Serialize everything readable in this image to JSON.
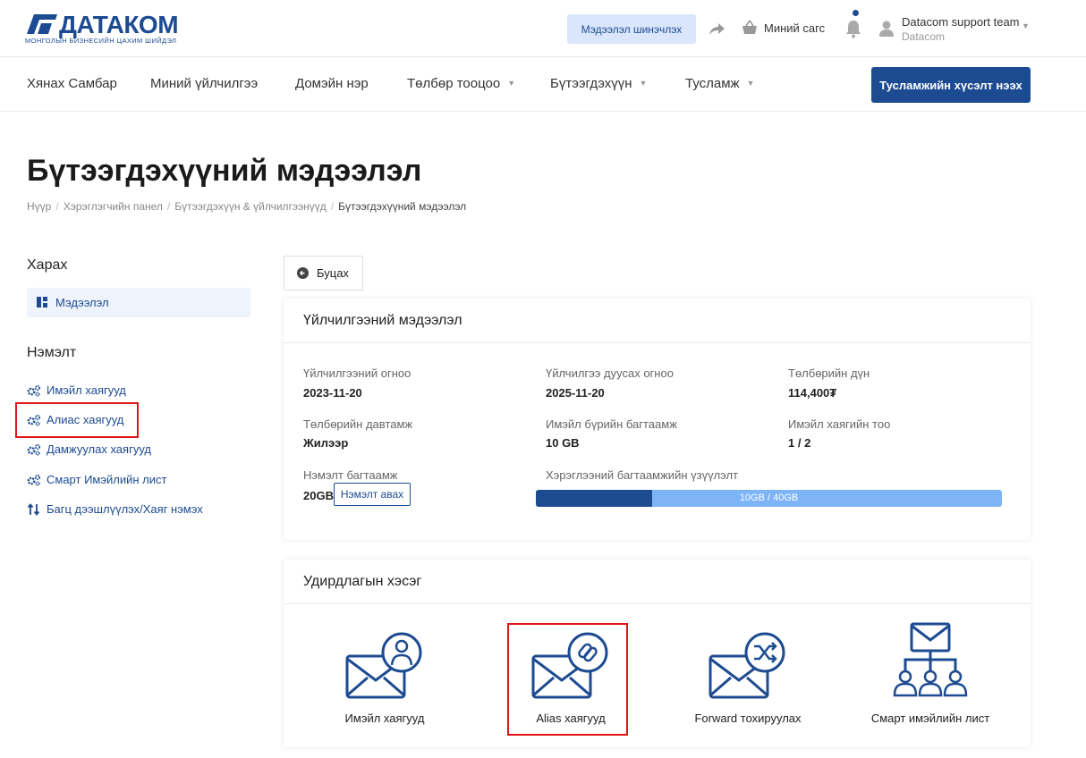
{
  "brand": {
    "name": "ДАТАКОМ",
    "tagline": "МОНГОЛЫН БИЗНЕСИЙН ЦАХИМ ШИЙДЭЛ",
    "color": "#1d4b91"
  },
  "header": {
    "update_label": "Мэдээлэл шинэчлэх",
    "cart_label": "Миний сагс",
    "user_name": "Datacom support team",
    "user_company": "Datacom"
  },
  "nav": {
    "items": [
      {
        "label": "Хянах Самбар"
      },
      {
        "label": "Миний үйлчилгээ"
      },
      {
        "label": "Домэйн нэр"
      },
      {
        "label": "Төлбөр тооцоо"
      },
      {
        "label": "Бүтээгдэхүүн"
      },
      {
        "label": "Тусламж"
      }
    ],
    "support_button": "Тусламжийн хүсэлт нээх"
  },
  "page": {
    "title": "Бүтээгдэхүүний мэдээлэл",
    "breadcrumb": [
      "Нүүр",
      "Хэрэглэгчийн панел",
      "Бүтээгдэхүүн & үйлчилгээнүүд",
      "Бүтээгдэхүүний мэдээлэл"
    ]
  },
  "sidebar": {
    "view_title": "Харах",
    "view_item": "Мэдээлэл",
    "extra_title": "Нэмэлт",
    "links": [
      {
        "label": "Имэйл хаягууд",
        "icon": "gears-icon"
      },
      {
        "label": "Алиас хаягууд",
        "icon": "gears-icon"
      },
      {
        "label": "Дамжуулах хаягууд",
        "icon": "gears-icon"
      },
      {
        "label": "Смарт Имэйлийн лист",
        "icon": "gears-icon"
      },
      {
        "label": "Багц дээшлүүлэх/Хаяг нэмэх",
        "icon": "updown-arrows-icon"
      }
    ]
  },
  "back_button": "Буцах",
  "service": {
    "title": "Үйлчилгээний мэдээлэл",
    "fields": [
      {
        "label": "Үйлчилгээний огноо",
        "value": "2023-11-20"
      },
      {
        "label": "Үйлчилгээ дуусах огноо",
        "value": "2025-11-20"
      },
      {
        "label": "Төлбөрийн дүн",
        "value": "114,400₮"
      },
      {
        "label": "Төлбөрийн давтамж",
        "value": "Жилээр"
      },
      {
        "label": "Имэйл бүрийн багтаамж",
        "value": "10 GB"
      },
      {
        "label": "Имэйл хаягийн тоо",
        "value": "1 / 2"
      }
    ],
    "addon_label": "Нэмэлт багтаамж",
    "addon_value": "20GB",
    "addon_button": "Нэмэлт авах",
    "usage_label": "Хэрэглээний багтаамжийн үзүүлэлт",
    "usage_text": "10GB / 40GB",
    "usage_fraction": 0.25
  },
  "control": {
    "title": "Удирдлагын хэсэг",
    "tiles": [
      {
        "label": "Имэйл хаягууд",
        "icon": "email-user-icon"
      },
      {
        "label": "Alias хаягууд",
        "icon": "email-link-icon"
      },
      {
        "label": "Forward тохируулах",
        "icon": "email-forward-icon"
      },
      {
        "label": "Смарт имэйлийн лист",
        "icon": "email-hierarchy-icon"
      }
    ]
  }
}
